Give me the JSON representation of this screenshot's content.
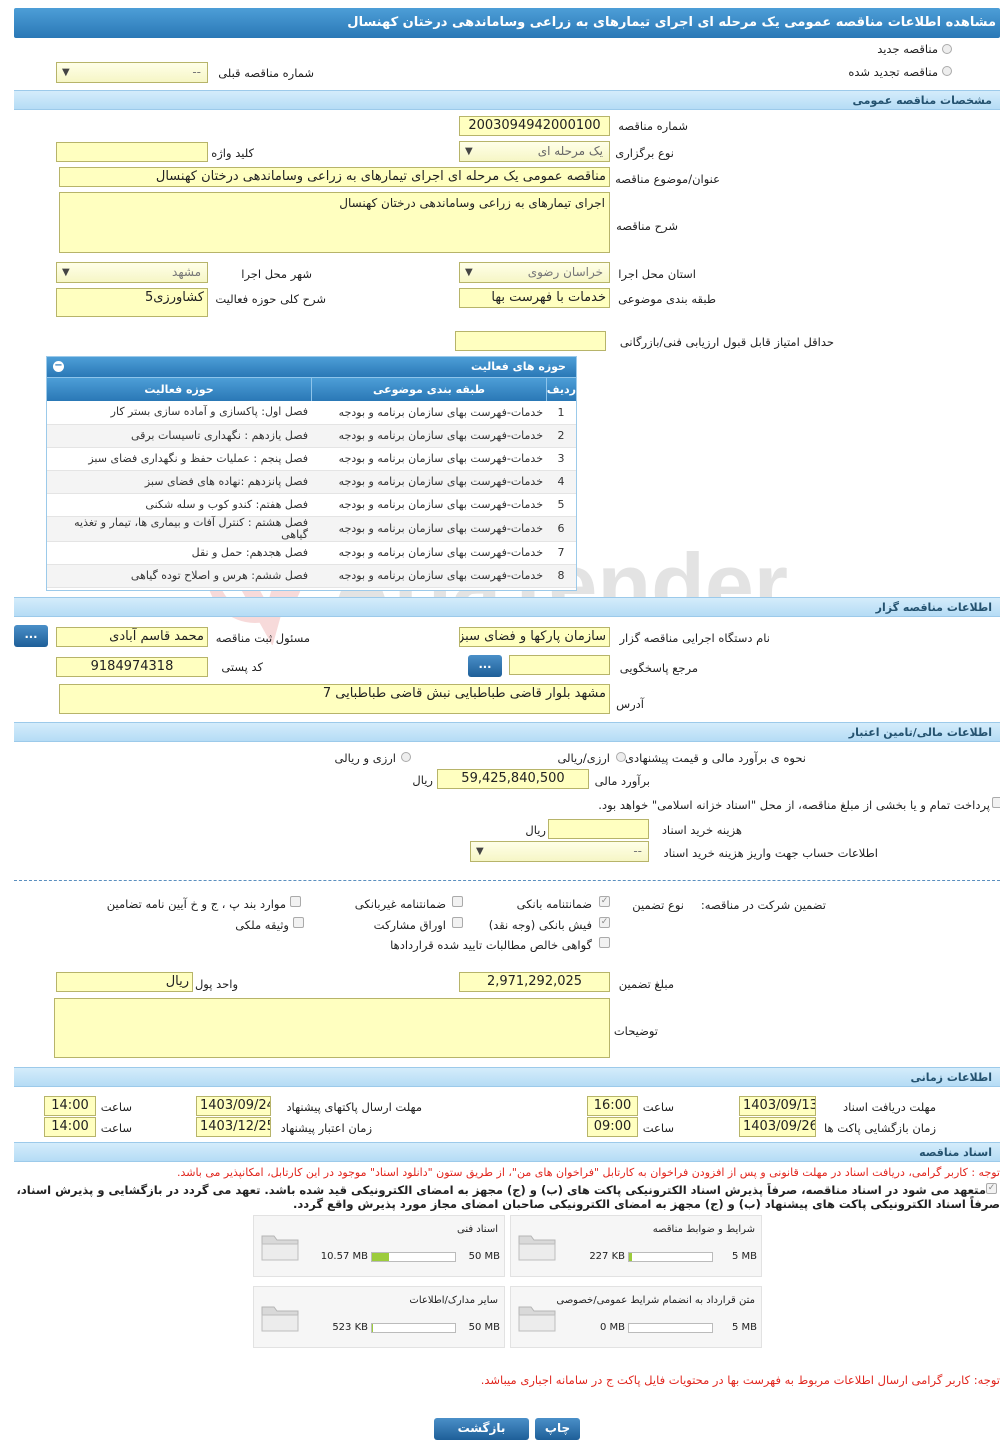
{
  "page_title": "مشاهده اطلاعات مناقصه عمومی یک مرحله ای اجرای تیمارهای به زراعی وساماندهی درختان کهنسال",
  "type": {
    "new": "مناقصه جدید",
    "renewed": "مناقصه تجدید شده",
    "prev_label": "شماره مناقصه قبلی",
    "prev_value": "--"
  },
  "general": {
    "header": "مشخصات مناقصه عمومی",
    "number_label": "شماره مناقصه",
    "number": "2003094942000100",
    "method_label": "نوع برگزاری",
    "method": "یک مرحله ای",
    "keyword_label": "کلید واژه",
    "keyword": "",
    "subject_label": "عنوان/موضوع مناقصه",
    "subject": "مناقصه عمومی یک مرحله ای اجرای تیمارهای به زراعی وساماندهی درختان کهنسال",
    "desc_label": "شرح مناقصه",
    "desc": "اجرای تیمارهای به زراعی وساماندهی درختان کهنسال",
    "province_label": "استان محل اجرا",
    "province": "خراسان رضوی",
    "city_label": "شهر محل اجرا",
    "city": "مشهد",
    "category_label": "طبقه بندی موضوعی",
    "category": "خدمات با فهرست بها",
    "scope_label": "شرح کلی حوزه فعالیت",
    "scope": "کشاورزی5",
    "min_score_label": "حداقل امتیاز قابل قبول ارزیابی فنی/بازرگانی",
    "min_score": ""
  },
  "activities": {
    "title": "حوزه های فعالیت",
    "columns": [
      "ردیف",
      "طبقه بندی موضوعی",
      "حوزه فعالیت"
    ],
    "rows": [
      [
        "1",
        "خدمات-فهرست بهای سازمان برنامه و بودجه",
        "فصل اول:  پاکسازی و آماده سازی بستر کار"
      ],
      [
        "2",
        "خدمات-فهرست بهای سازمان برنامه و بودجه",
        "فصل یازدهم : نگهداری تاسیسات برقی"
      ],
      [
        "3",
        "خدمات-فهرست بهای سازمان برنامه و بودجه",
        "فصل پنجم : عملیات حفظ و نگهداری فضای سبز"
      ],
      [
        "4",
        "خدمات-فهرست بهای سازمان برنامه و بودجه",
        "فصل پانزدهم :نهاده های فضای سبز"
      ],
      [
        "5",
        "خدمات-فهرست بهای سازمان برنامه و بودجه",
        "فصل هفتم: کندو کوب و سله شکنی"
      ],
      [
        "6",
        "خدمات-فهرست بهای سازمان برنامه و بودجه",
        "فصل هشتم : کنترل آفات و بیماری ها، تیمار و تغذیه گیاهی"
      ],
      [
        "7",
        "خدمات-فهرست بهای سازمان برنامه و بودجه",
        "فصل هجدهم: حمل و نقل"
      ],
      [
        "8",
        "خدمات-فهرست بهای سازمان برنامه و بودجه",
        "فصل ششم: هرس و اصلاح توده گیاهی"
      ]
    ]
  },
  "organizer": {
    "header": "اطلاعات مناقصه گزار",
    "org_label": "نام دستگاه اجرایی مناقصه گزار",
    "org": "سازمان پارکها و فضای سبز",
    "registrar_label": "مسئول ثبت مناقصه",
    "registrar": "محمد قاسم آبادی",
    "ref_label": "مرجع پاسخگویی",
    "ref": "",
    "postal_label": "کد پستی",
    "postal": "9184974318",
    "address_label": "آدرس",
    "address": "مشهد بلوار قاضی طباطبایی  نبش قاضی طباطبایی 7",
    "more": "..."
  },
  "finance": {
    "header": "اطلاعات مالی/تامین اعتبار",
    "pricing_label": "نحوه ی برآورد مالی و قیمت پیشنهادی",
    "opt1": "ارزی/ریالی",
    "opt2": "ارزی و ریالی",
    "estimate_label": "برآورد مالی",
    "estimate": "59,425,840,500",
    "currency": "ریال",
    "treasury": "پرداخت تمام و یا بخشی از مبلغ مناقصه، از محل \"اسناد خزانه اسلامی\" خواهد بود.",
    "doc_fee_label": "هزینه خرید اسناد",
    "doc_fee": "",
    "doc_fee_unit": "ریال",
    "account_label": "اطلاعات حساب جهت واریز هزینه خرید اسناد",
    "account": "--"
  },
  "guarantee": {
    "participation_label": "تضمین شرکت در مناقصه:",
    "type_label": "نوع تضمین",
    "options": [
      "ضمانتنامه بانکی",
      "ضمانتنامه غیربانکی",
      "موارد بند پ ، ج و خ آیین نامه تضامین",
      "فیش بانکی (وجه نقد)",
      "اوراق مشارکت",
      "وثیقه ملکی",
      "گواهی خالص مطالبات تایید شده قراردادها"
    ],
    "amount_label": "مبلغ تضمین",
    "amount": "2,971,292,025",
    "unit_label": "واحد پول",
    "unit": "ریال",
    "notes_label": "توضیحات",
    "notes": ""
  },
  "timing": {
    "header": "اطلاعات زمانی",
    "doc_receive_label": "مهلت دریافت اسناد",
    "doc_receive_date": "1403/09/13",
    "doc_receive_time": "16:00",
    "submit_label": "مهلت ارسال پاکتهای پیشنهاد",
    "submit_date": "1403/09/24",
    "submit_time": "14:00",
    "open_label": "زمان بازگشایی پاکت ها",
    "open_date": "1403/09/26",
    "open_time": "09:00",
    "validity_label": "زمان اعتبار پیشنهاد",
    "validity_date": "1403/12/25",
    "validity_time": "14:00",
    "time_label": "ساعت"
  },
  "documents": {
    "header": "اسناد مناقصه",
    "note1": "توجه : کاربر گرامی، دریافت اسناد در مهلت قانونی و پس از افزودن فراخوان به کارتابل \"فراخوان های من\"، از طریق ستون \"دانلود اسناد\" موجود در این کارتابل، امکانپذیر می باشد.",
    "commit_line1": "متعهد می شود در اسناد مناقصه، صرفاً پذیرش اسناد الکترونیکی پاکت های (ب) و (ج) مجهز به امضای الکترونیکی قید شده باشد. تعهد می گردد در بازگشایی و پذیرش اسناد،",
    "commit_line2": "صرفاً اسناد الکترونیکی پاکت های پیشنهاد (ب) و (ج) مجهز به امضای الکترونیکی صاحبان امضای مجاز مورد پذیرش واقع گردد.",
    "files": [
      {
        "name": "شرایط و ضوابط مناقصه",
        "size": "227 KB",
        "max": "5 MB",
        "fill": 0.04
      },
      {
        "name": "اسناد فنی",
        "size": "10.57 MB",
        "max": "50 MB",
        "fill": 0.21
      },
      {
        "name": "متن قرارداد به انضمام شرایط عمومی/خصوصی",
        "size": "0 MB",
        "max": "5 MB",
        "fill": 0
      },
      {
        "name": "سایر مدارک/اطلاعات",
        "size": "523 KB",
        "max": "50 MB",
        "fill": 0.01
      }
    ],
    "note2": "توجه: کاربر گرامی ارسال اطلاعات مربوط به فهرست بها در محتویات فایل پاکت ج در سامانه اجباری میباشد."
  },
  "actions": {
    "back": "بازگشت",
    "print": "چاپ"
  },
  "colors": {
    "header_bar": "#2a78b6",
    "section_bar": "#b5dcf5",
    "field_bg": "#ffffc0",
    "note_red": "#e0261e"
  }
}
